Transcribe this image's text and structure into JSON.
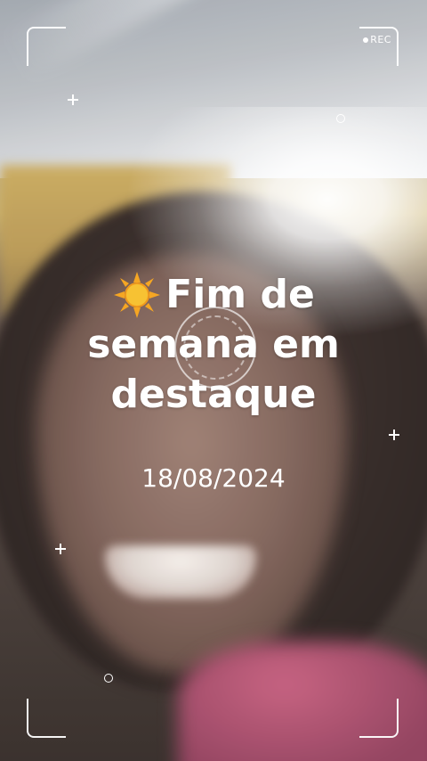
{
  "overlay": {
    "rec_label": "REC",
    "title_line1": "Fim de",
    "title_line2": "semana em",
    "title_line3": "destaque",
    "date": "18/08/2024",
    "title_icon": "sun-icon"
  },
  "colors": {
    "frame": "#ffffff",
    "text": "#ffffff",
    "sun": "#f5a623"
  }
}
